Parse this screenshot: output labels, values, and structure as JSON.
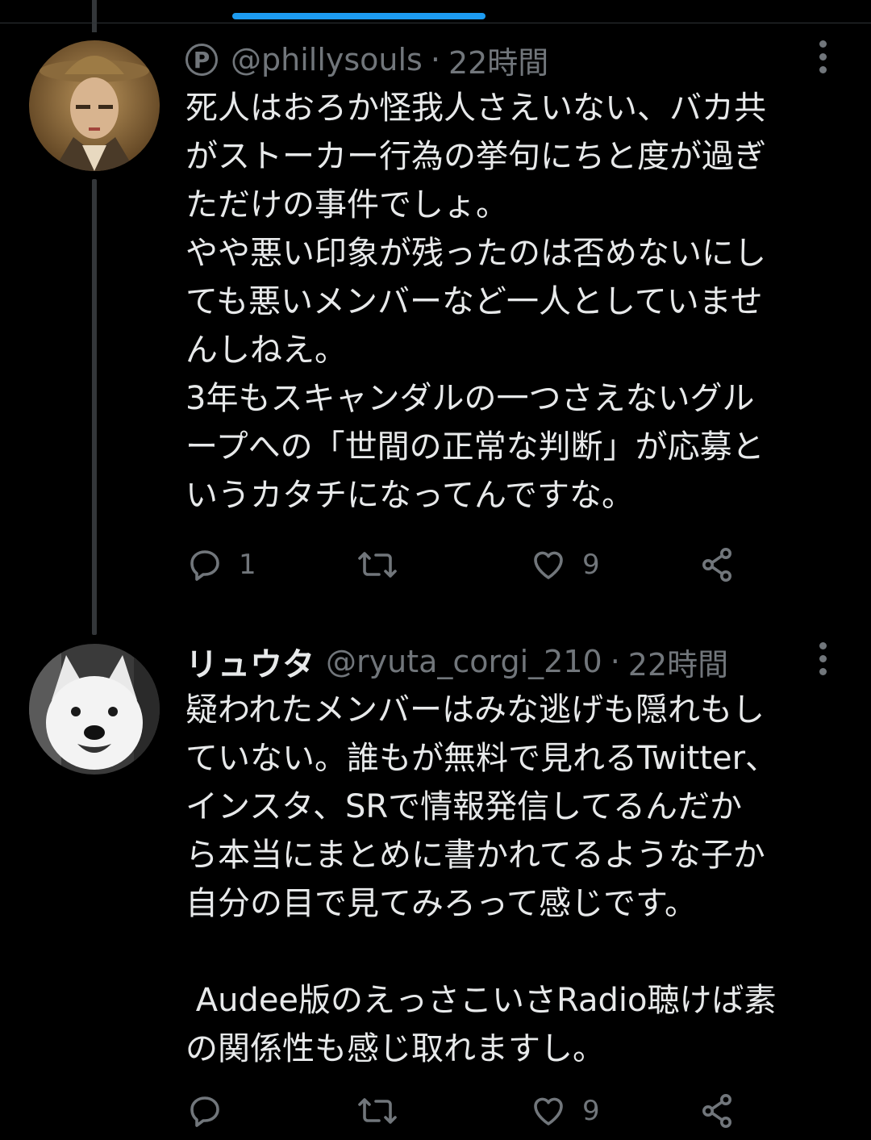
{
  "tweets": [
    {
      "name": "",
      "handle": "@phillysouls",
      "separator": "·",
      "time": "22時間",
      "badge": "P",
      "lines": [
        "死人はおろか怪我人さえいない、バカ共",
        "がストーカー行為の挙句にちと度が過ぎ",
        "ただけの事件でしょ。",
        "やや悪い印象が残ったのは否めないにし",
        "ても悪いメンバーなど一人としていませ",
        "んしねえ。",
        "3年もスキャンダルの一つさえないグル",
        "ープへの「世間の正常な判断」が応募と",
        "いうカタチになってんですな。"
      ],
      "reply_count": "1",
      "retweet_count": "",
      "like_count": "9"
    },
    {
      "name": "リュウタ",
      "handle": "@ryuta_corgi_210",
      "separator": "·",
      "time": "22時間",
      "lines": [
        "疑われたメンバーはみな逃げも隠れもし",
        "ていない。誰もが無料で見れるTwitter、",
        "インスタ、SRで情報発信してるんだか",
        "ら本当にまとめに書かれてるような子か",
        "自分の目で見てみろって感じです。",
        "",
        " Audee版のえっさこいさRadio聴けば素",
        "の関係性も感じ取れますし。"
      ],
      "reply_count": "",
      "retweet_count": "",
      "like_count": "9"
    }
  ],
  "icons": {
    "reply": "reply-icon",
    "retweet": "retweet-icon",
    "like": "heart-icon",
    "share": "share-icon",
    "more": "more-icon"
  },
  "colors": {
    "background": "#000000",
    "text": "#e7e9ea",
    "secondary": "#71767b",
    "accent": "#1d9bf0",
    "thread_line": "#333639"
  }
}
